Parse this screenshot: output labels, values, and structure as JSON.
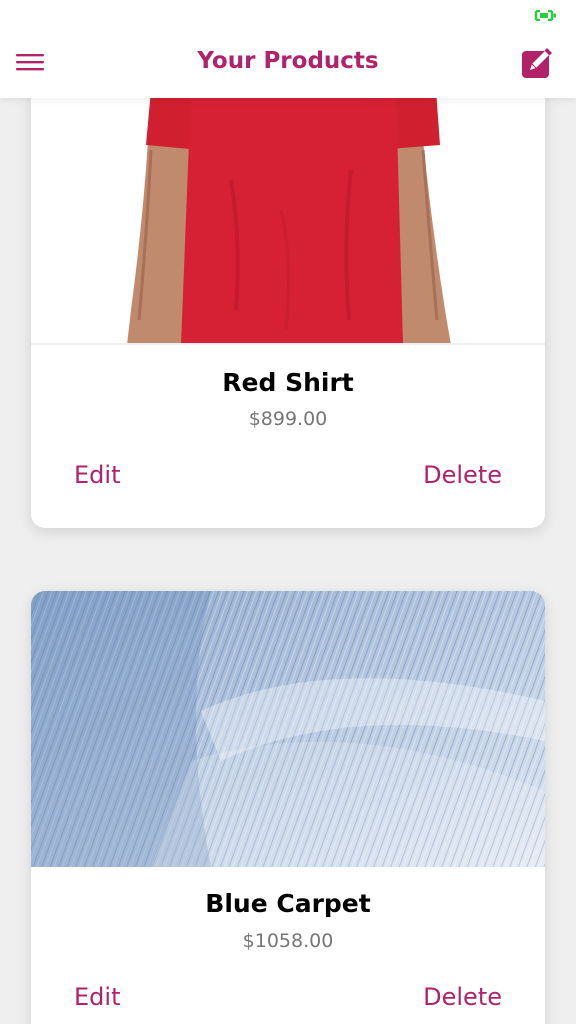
{
  "header": {
    "title": "Your Products",
    "menu_icon": "hamburger-menu-icon",
    "add_icon": "edit-square-icon",
    "accent_color": "#b22269"
  },
  "status_bar": {
    "battery_icon": "battery-icon",
    "battery_color": "#2ecc40"
  },
  "products": [
    {
      "title": "Red Shirt",
      "price": "$899.00",
      "image": "red-shirt-image",
      "edit_label": "Edit",
      "delete_label": "Delete"
    },
    {
      "title": "Blue Carpet",
      "price": "$1058.00",
      "image": "blue-carpet-image",
      "edit_label": "Edit",
      "delete_label": "Delete"
    }
  ]
}
